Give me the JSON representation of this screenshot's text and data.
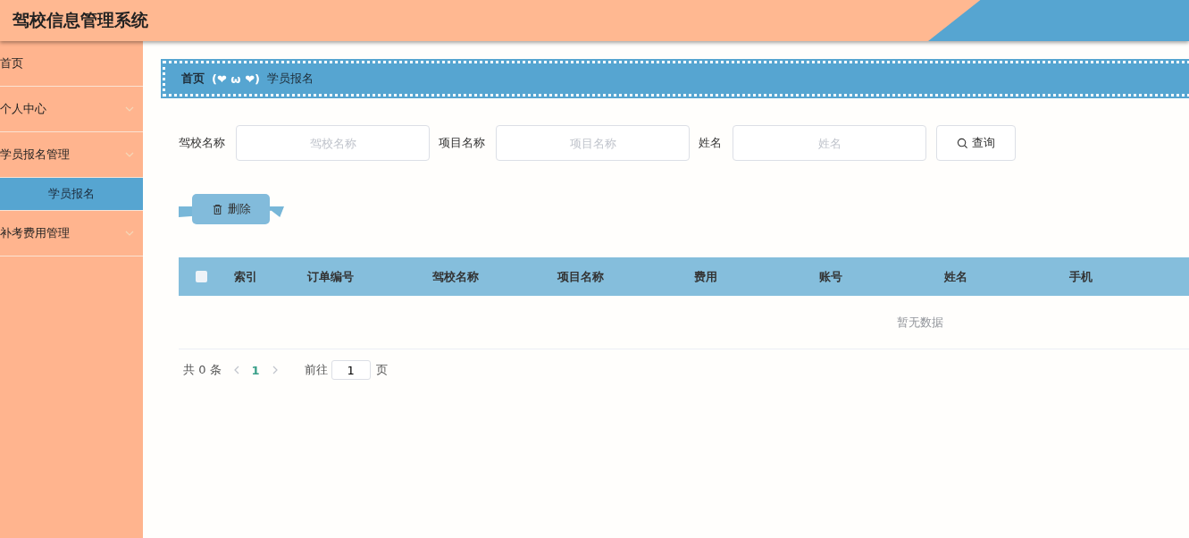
{
  "header": {
    "title": "驾校信息管理系统"
  },
  "sidebar": {
    "items": [
      {
        "kind": "link",
        "label": "首页",
        "selected": false
      },
      {
        "kind": "group",
        "label": "个人中心",
        "selected": false
      },
      {
        "kind": "group",
        "label": "学员报名管理",
        "selected": false,
        "expanded": true,
        "children": [
          {
            "label": "学员报名",
            "selected": true
          }
        ]
      },
      {
        "kind": "group",
        "label": "补考费用管理",
        "selected": false
      }
    ]
  },
  "breadcrumb": {
    "items": [
      "首页",
      "学员报名"
    ],
    "separator": "(❤ ω ❤)"
  },
  "search": {
    "fields": [
      {
        "label": "驾校名称",
        "placeholder": "驾校名称"
      },
      {
        "label": "项目名称",
        "placeholder": "项目名称"
      },
      {
        "label": "姓名",
        "placeholder": "姓名"
      }
    ],
    "button": "查询"
  },
  "actions": {
    "delete": "删除"
  },
  "table": {
    "select_all": false,
    "columns": [
      "索引",
      "订单编号",
      "驾校名称",
      "项目名称",
      "费用",
      "账号",
      "姓名",
      "手机"
    ],
    "empty_text": "暂无数据"
  },
  "pagination": {
    "total": "共 0 条",
    "pages": [
      {
        "label": "1",
        "selected": true
      }
    ],
    "goto_label": "前往",
    "goto_value": "1",
    "page_suffix": "页"
  }
}
